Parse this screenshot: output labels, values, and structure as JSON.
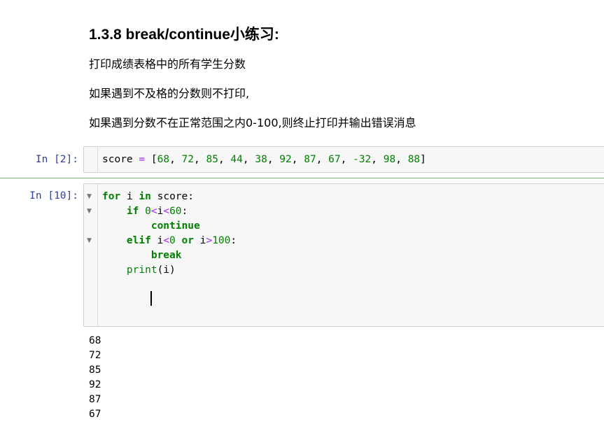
{
  "markdown": {
    "heading": "1.3.8  break/continue小练习:",
    "paragraphs": [
      "打印成绩表格中的所有学生分数",
      "如果遇到不及格的分数则不打印,",
      "如果遇到分数不在正常范围之内0-100,则终止打印并输出错误消息"
    ]
  },
  "cells": [
    {
      "prompt": "In [2]:",
      "code": {
        "var": "score",
        "eq": "=",
        "open": "[",
        "list": [
          "68",
          "72",
          "85",
          "44",
          "38",
          "92",
          "87",
          "67",
          "-32",
          "98",
          "88"
        ],
        "close": "]"
      }
    },
    {
      "prompt": "In [10]:",
      "code": {
        "for": "for",
        "i": "i",
        "in": "in",
        "iter": "score:",
        "if": "if",
        "zero": "0",
        "lt": "<",
        "sixty": "60",
        "colon": ":",
        "continue": "continue",
        "elif": "elif",
        "zero2": "0",
        "or": "or",
        "gt": ">",
        "hundred": "100",
        "break": "break",
        "print": "print",
        "print_args": "(i)"
      }
    }
  ],
  "output": [
    "68",
    "72",
    "85",
    "92",
    "87",
    "67"
  ]
}
